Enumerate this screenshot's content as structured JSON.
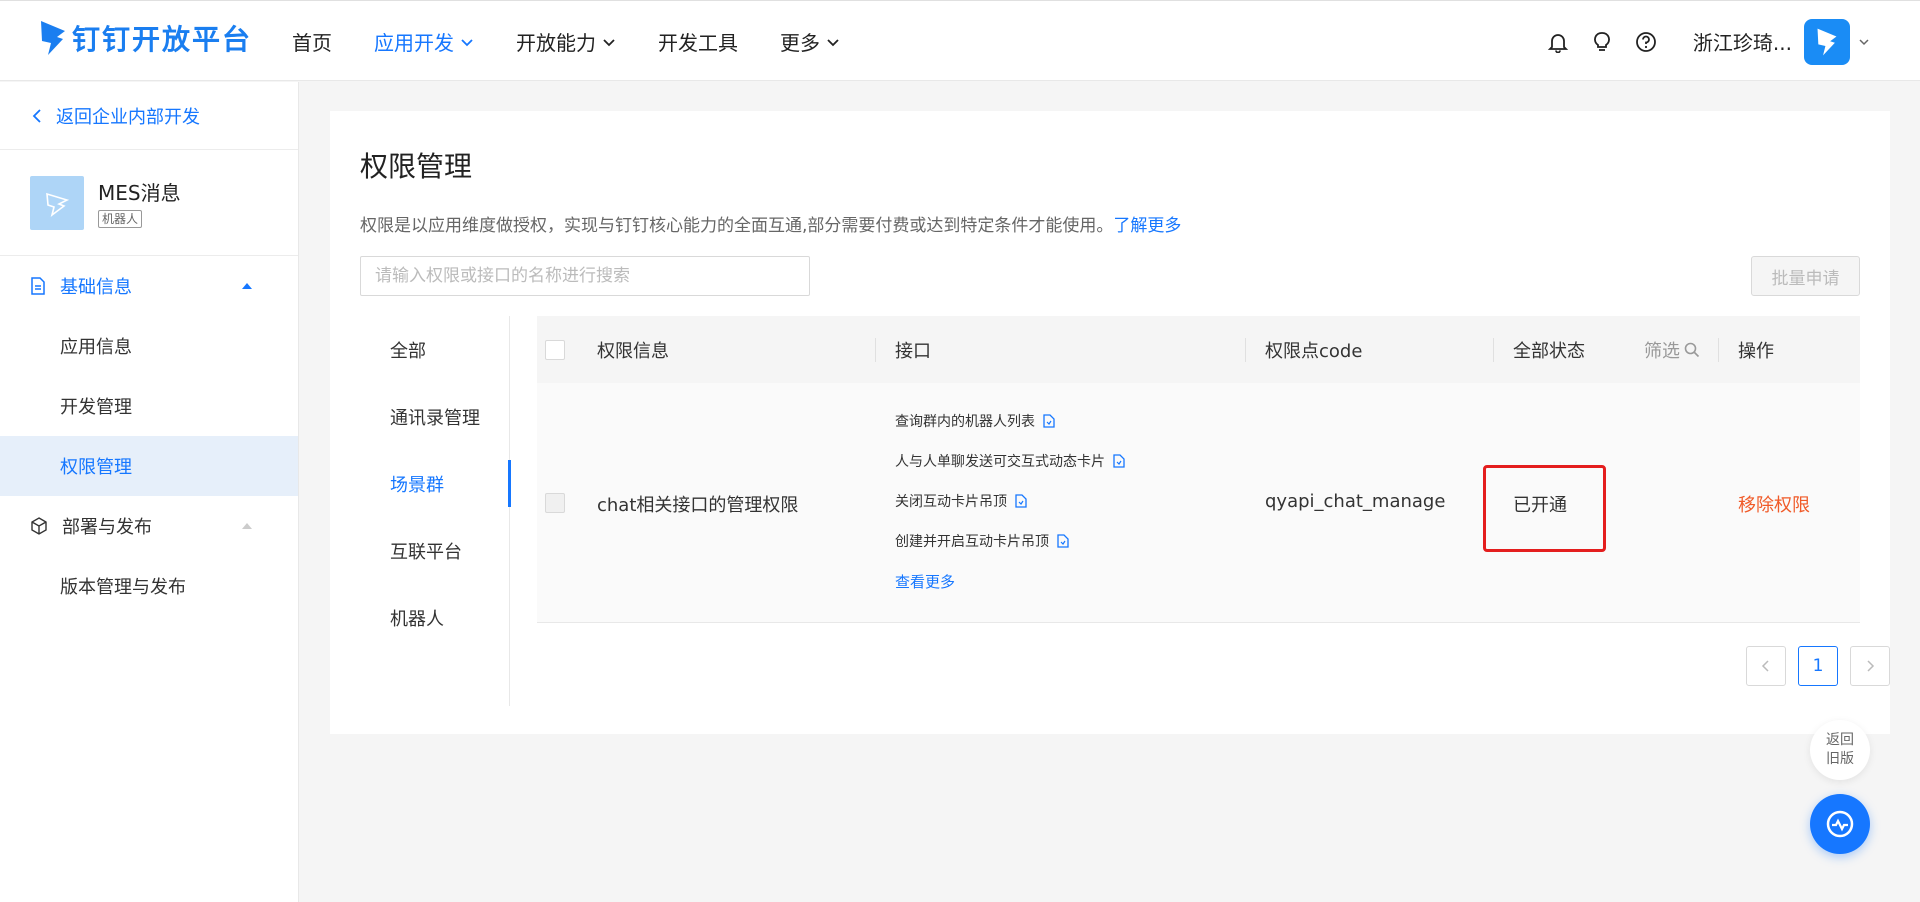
{
  "brand": {
    "name": "钉钉开放平台",
    "color": "#1a7ef0"
  },
  "nav": {
    "items": [
      {
        "label": "首页",
        "dropdown": false,
        "active": false
      },
      {
        "label": "应用开发",
        "dropdown": true,
        "active": true
      },
      {
        "label": "开放能力",
        "dropdown": true,
        "active": false
      },
      {
        "label": "开发工具",
        "dropdown": false,
        "active": false
      },
      {
        "label": "更多",
        "dropdown": true,
        "active": false
      }
    ],
    "icons": [
      "bell-icon",
      "lightbulb-icon",
      "help-icon"
    ],
    "org_name": "浙江珍琦..."
  },
  "sidebar": {
    "back_label": "返回企业内部开发",
    "app": {
      "name": "MES消息",
      "tag": "机器人"
    },
    "groups": [
      {
        "label": "基础信息",
        "open": true,
        "items": [
          "应用信息",
          "开发管理",
          "权限管理"
        ],
        "selected": "权限管理"
      },
      {
        "label": "部署与发布",
        "open": false,
        "items": [
          "版本管理与发布"
        ]
      }
    ]
  },
  "main": {
    "title": "权限管理",
    "description": "权限是以应用维度做授权，实现与钉钉核心能力的全面互通,部分需要付费或达到特定条件才能使用。",
    "learn_more": "了解更多",
    "search_placeholder": "请输入权限或接口的名称进行搜索",
    "batch_button": "批量申请",
    "categories": [
      "全部",
      "通讯录管理",
      "场景群",
      "互联平台",
      "机器人"
    ],
    "active_category": "场景群",
    "table": {
      "headers": {
        "info": "权限信息",
        "api": "接口",
        "code": "权限点code",
        "status": "全部状态",
        "filter": "筛选",
        "action": "操作"
      },
      "rows": [
        {
          "info": "chat相关接口的管理权限",
          "apis": [
            "查询群内的机器人列表",
            "人与人单聊发送可交互式动态卡片",
            "关闭互动卡片吊顶",
            "创建并开启互动卡片吊顶"
          ],
          "more": "查看更多",
          "code": "qyapi_chat_manage",
          "status": "已开通",
          "action": "移除权限"
        }
      ]
    },
    "pagination": {
      "current": "1"
    }
  },
  "floating": {
    "old_version_line1": "返回",
    "old_version_line2": "旧版"
  },
  "colors": {
    "primary": "#1677ff",
    "danger_link": "#f05a28",
    "highlight_box": "#e41e1e"
  }
}
